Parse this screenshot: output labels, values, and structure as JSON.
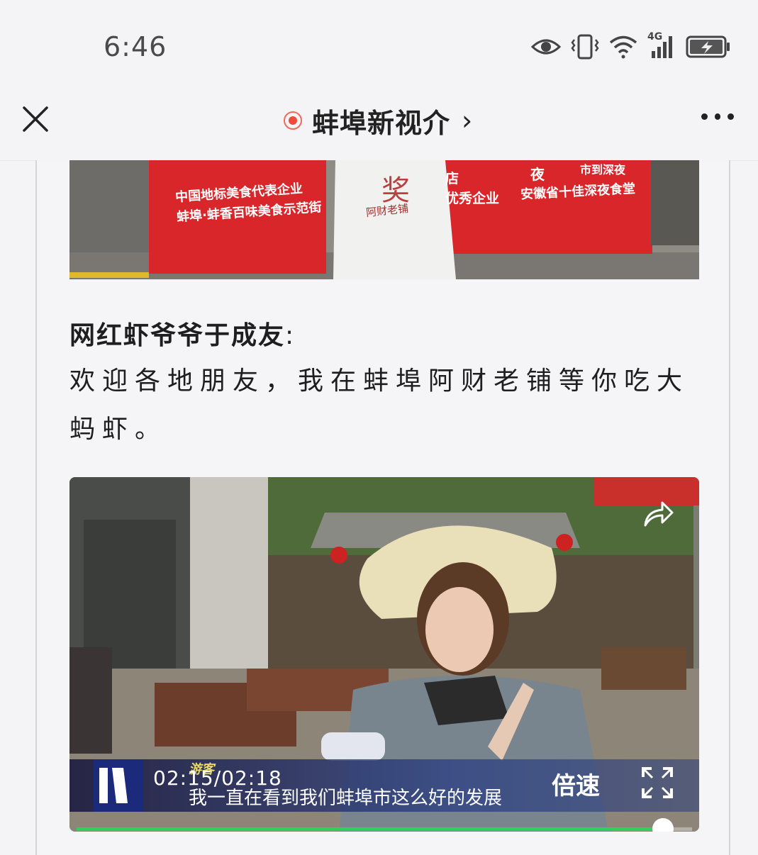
{
  "status_bar": {
    "time": "6:46",
    "network_label": "4G",
    "icons": [
      "eye-icon",
      "vibrate-icon",
      "wifi-icon",
      "signal-icon",
      "battery-charging-icon"
    ]
  },
  "nav_bar": {
    "title": "蚌埠新视介",
    "chevron": "›",
    "icons": [
      "close-icon",
      "live-dot-icon",
      "more-icon"
    ]
  },
  "top_image": {
    "banner_left_line1": "中国地标美食代表企业",
    "banner_left_line2": "蚌埠·蚌香百味美食示范街",
    "shirt_text_big": "奖",
    "shirt_text_small": "阿财老铺",
    "banner_mid": "店\n优秀企业",
    "banner_right_line1": "夜",
    "banner_right_line2": "市到深夜",
    "banner_right_line3": "安徽省十佳深夜食堂"
  },
  "article": {
    "speaker": "网红虾爷爷于成友",
    "speaker_colon": ":",
    "quote": "欢迎各地朋友，我在蚌埠阿财老铺等你吃大蚂虾。"
  },
  "video": {
    "guest_tag": "游客",
    "subtitle": "我一直在看到我们蚌埠市这么好的发展",
    "time_readout": "02:15/02:18",
    "speed_label": "倍速",
    "progress": 0.953,
    "colors": {
      "progress": "#2fd05c",
      "live_dot": "#ee4b3a"
    },
    "icons": [
      "share-icon",
      "fullscreen-icon",
      "channel-logo-icon"
    ]
  }
}
